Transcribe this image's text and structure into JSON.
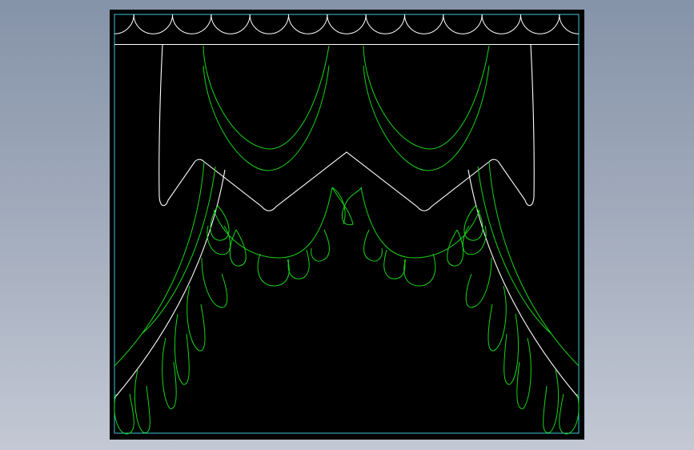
{
  "colors": {
    "background": "#8f9aae",
    "viewport": "#000000",
    "frame": "#3fc6d8",
    "outline": "#ffffff",
    "drape": "#18d418"
  }
}
